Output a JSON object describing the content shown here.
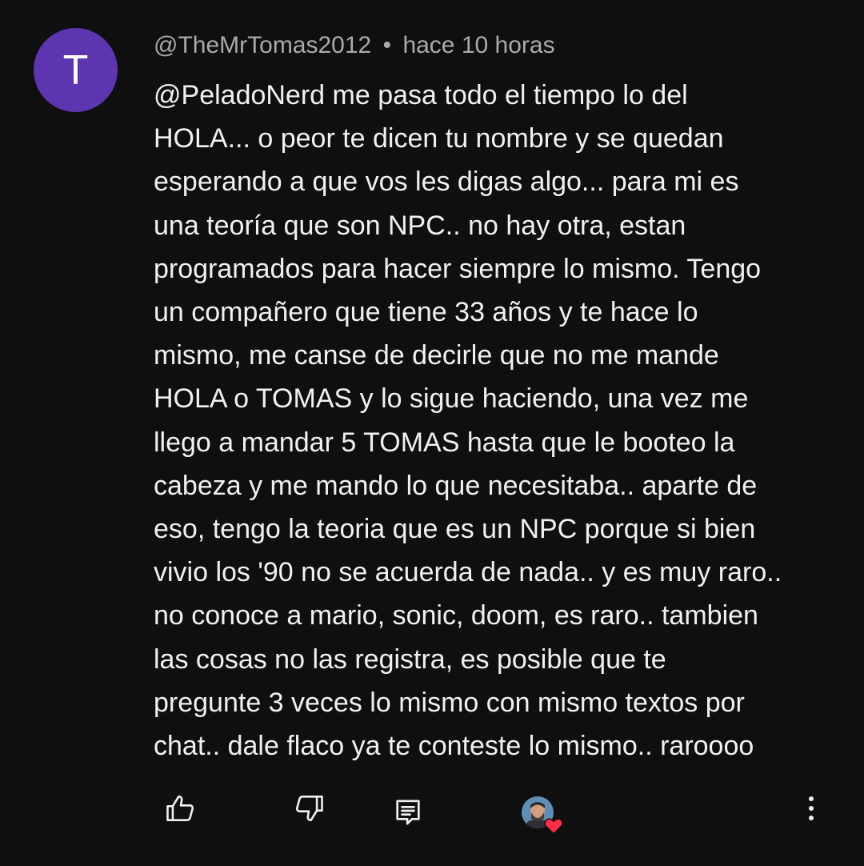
{
  "comment": {
    "author_initial": "T",
    "author_handle": "@TheMrTomas2012",
    "separator": "•",
    "timestamp": "hace 10 horas",
    "body": "@PeladoNerd me pasa todo el tiempo lo del\nHOLA... o peor te dicen tu nombre y se quedan\nesperando a que vos les digas algo... para mi es\nuna teoría que son NPC.. no hay otra, estan\nprogramados para hacer siempre lo mismo. Tengo\nun compañero que tiene 33 años y te hace lo\nmismo, me canse de decirle que no me mande\nHOLA o TOMAS y lo sigue haciendo, una vez me\nllego a mandar 5 TOMAS hasta que le booteo la\ncabeza y me mando lo que necesitaba.. aparte de\neso, tengo la teoria que es un NPC porque si bien\nvivio los '90 no se acuerda de nada.. y es muy raro..\nno conoce a mario, sonic, doom, es raro.. tambien\nlas cosas no las registra, es posible que te\npregunte 3 veces lo mismo con mismo textos por\nchat.. dale flaco ya te conteste lo mismo.. raroooo"
  },
  "actions": {
    "like_icon": "thumbs-up-icon",
    "dislike_icon": "thumbs-down-icon",
    "reply_icon": "comment-reply-icon",
    "creator_heart_icon": "creator-heart-icon",
    "more_icon": "more-vertical-icon"
  },
  "colors": {
    "background": "#0f0f0f",
    "avatar": "#5e35b1",
    "text_primary": "#f1f1f1",
    "text_secondary": "#aaaaaa",
    "heart": "#ff2e44"
  }
}
